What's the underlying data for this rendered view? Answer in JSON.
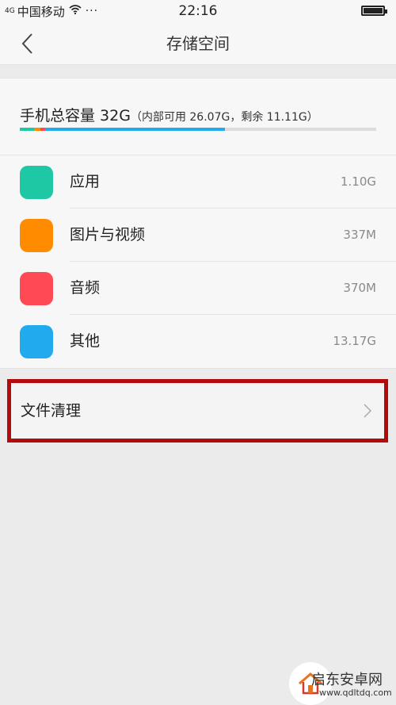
{
  "status_bar": {
    "signal": "4G",
    "carrier": "中国移动",
    "wifi_icon": "wifi-icon",
    "more": "···",
    "time": "22:16",
    "battery_level": 1.0
  },
  "header": {
    "back_icon": "chevron-left-icon",
    "title": "存储空间"
  },
  "capacity": {
    "main": "手机总容量 32G",
    "detail": "（内部可用 26.07G，剩余 11.11G）",
    "usage_segments": [
      {
        "name": "应用",
        "fraction": 0.04,
        "color": "#1ec8a5"
      },
      {
        "name": "图片与视频",
        "fraction": 0.018,
        "color": "#ff8c00"
      },
      {
        "name": "音频",
        "fraction": 0.013,
        "color": "#ff4a55"
      },
      {
        "name": "其他",
        "fraction": 0.505,
        "color": "#22aaee"
      }
    ]
  },
  "storage_items": [
    {
      "label": "应用",
      "size": "1.10G",
      "color": "#1ec8a5"
    },
    {
      "label": "图片与视频",
      "size": "337M",
      "color": "#ff8c00"
    },
    {
      "label": "音频",
      "size": "370M",
      "color": "#ff4a55"
    },
    {
      "label": "其他",
      "size": "13.17G",
      "color": "#22aaee"
    }
  ],
  "file_clean": {
    "label": "文件清理",
    "arrow_icon": "chevron-right-icon",
    "highlight_color": "#b30b0b"
  },
  "watermark": {
    "title": "启东安卓网",
    "url": "www.qdltdq.com",
    "logo_icon": "house-logo-icon"
  }
}
